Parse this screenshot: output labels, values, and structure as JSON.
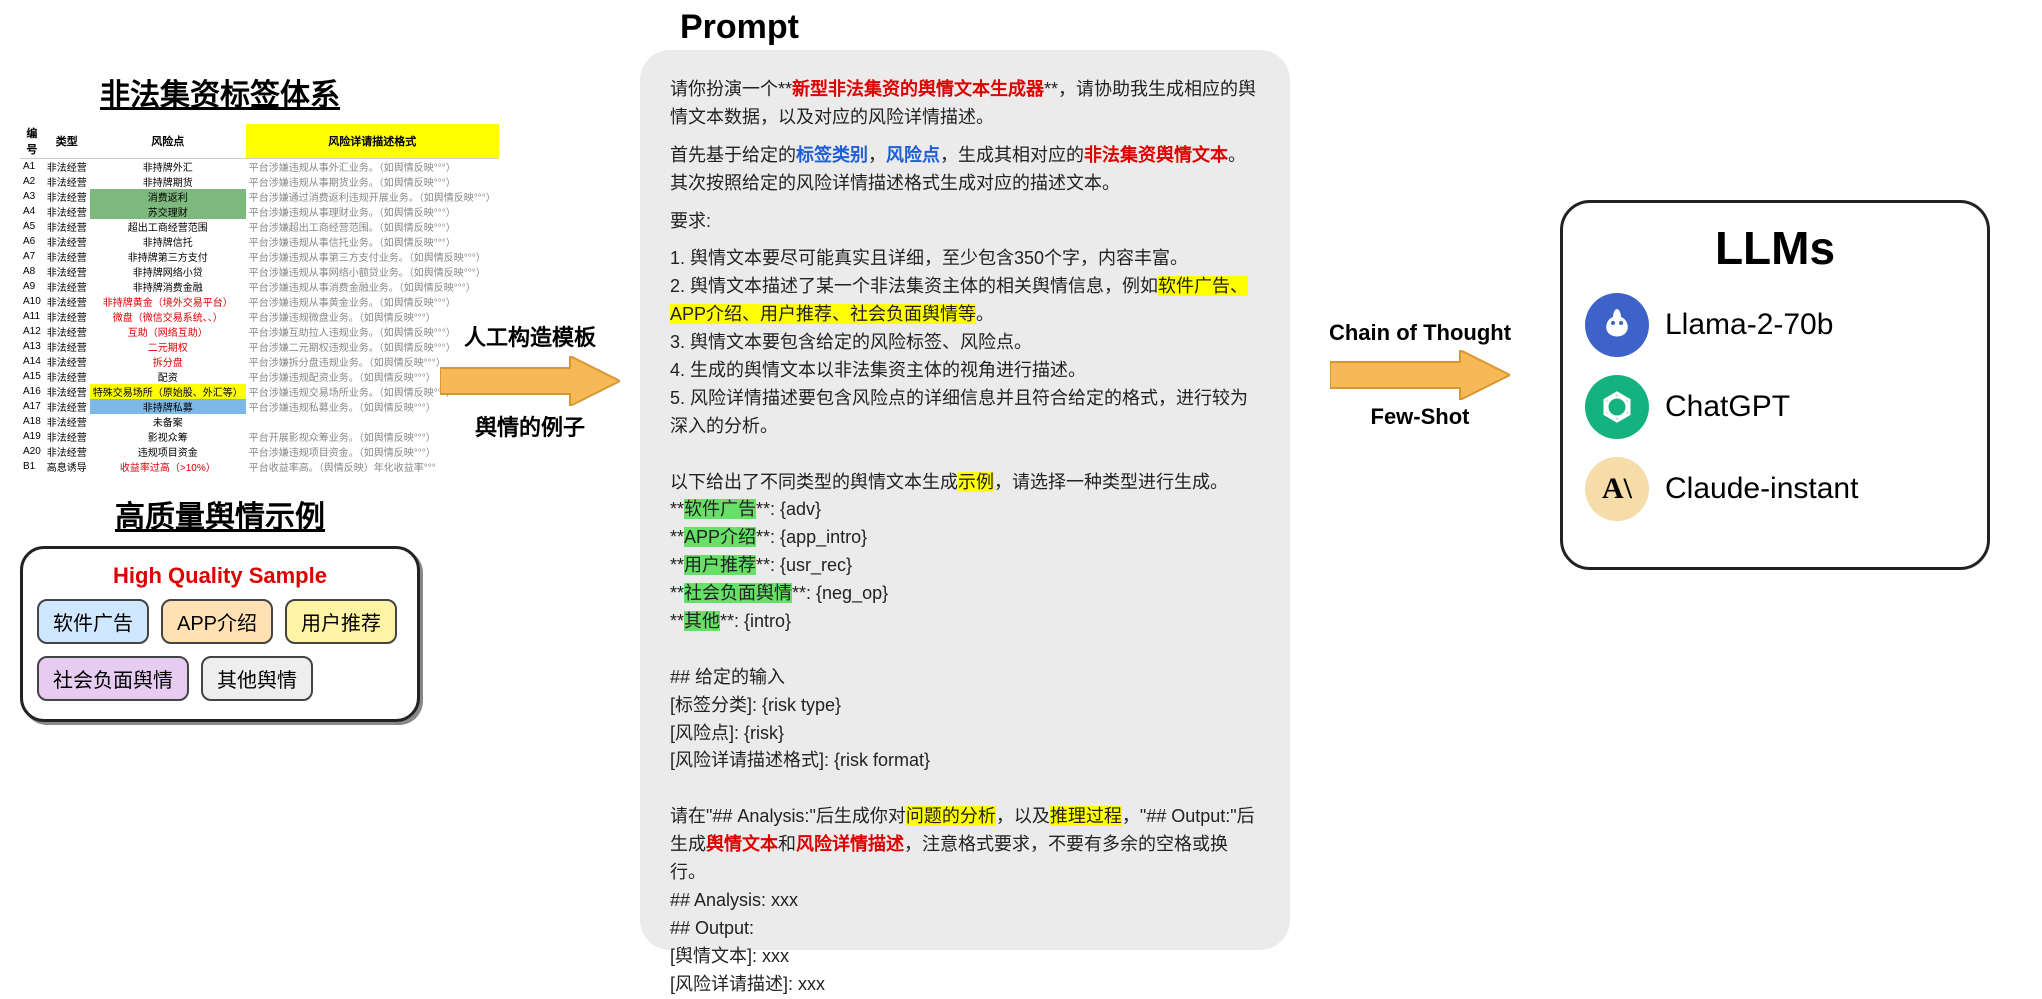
{
  "left": {
    "tag_system_title": "非法集资标签体系",
    "headers": {
      "c1": "编号",
      "c2": "类型",
      "c3": "风险点",
      "c4": "风险详请描述格式"
    },
    "rows": [
      {
        "id": "A1",
        "type": "非法经营",
        "risk": "非持牌外汇",
        "desc": "平台涉嫌违规从事外汇业务。（如舆情反映°°°）",
        "cls": ""
      },
      {
        "id": "A2",
        "type": "非法经营",
        "risk": "非持牌期货",
        "desc": "平台涉嫌违规从事期货业务。（如舆情反映°°°）",
        "cls": ""
      },
      {
        "id": "A3",
        "type": "非法经营",
        "risk": "消费返利",
        "desc": "平台涉嫌通过消费返利违规开展业务。（如舆情反映°°°）",
        "cls": "green-cell"
      },
      {
        "id": "A4",
        "type": "非法经营",
        "risk": "苏交理财",
        "desc": "平台涉嫌违规从事理财业务。（如舆情反映°°°）",
        "cls": "green-cell"
      },
      {
        "id": "A5",
        "type": "非法经营",
        "risk": "超出工商经营范围",
        "desc": "平台涉嫌超出工商经营范围。（如舆情反映°°°）",
        "cls": ""
      },
      {
        "id": "A6",
        "type": "非法经营",
        "risk": "非持牌信托",
        "desc": "平台涉嫌违规从事信托业务。（如舆情反映°°°）",
        "cls": ""
      },
      {
        "id": "A7",
        "type": "非法经营",
        "risk": "非持牌第三方支付",
        "desc": "平台涉嫌违规从事第三方支付业务。（如舆情反映°°°）",
        "cls": ""
      },
      {
        "id": "A8",
        "type": "非法经营",
        "risk": "非持牌网络小贷",
        "desc": "平台涉嫌违规从事网络小额贷业务。（如舆情反映°°°）",
        "cls": ""
      },
      {
        "id": "A9",
        "type": "非法经营",
        "risk": "非持牌消费金融",
        "desc": "平台涉嫌违规从事消费金融业务。（如舆情反映°°°）",
        "cls": ""
      },
      {
        "id": "A10",
        "type": "非法经营",
        "risk": "非持牌黄金（境外交易平台）",
        "desc": "平台涉嫌违规从事黄金业务。（如舆情反映°°°）",
        "cls": "red-text"
      },
      {
        "id": "A11",
        "type": "非法经营",
        "risk": "微盘（微信交易系统、、）",
        "desc": "平台涉嫌违规微盘业务。（如舆情反映°°°）",
        "cls": "red-text"
      },
      {
        "id": "A12",
        "type": "非法经营",
        "risk": "互助（网络互助）",
        "desc": "平台涉嫌互助拉人违规业务。（如舆情反映°°°）",
        "cls": "red-text"
      },
      {
        "id": "A13",
        "type": "非法经营",
        "risk": "二元期权",
        "desc": "平台涉嫌二元期权违规业务。（如舆情反映°°°）",
        "cls": "red-text"
      },
      {
        "id": "A14",
        "type": "非法经营",
        "risk": "拆分盘",
        "desc": "平台涉嫌拆分盘违规业务。（如舆情反映°°°）",
        "cls": "red-text"
      },
      {
        "id": "A15",
        "type": "非法经营",
        "risk": "配资",
        "desc": "平台涉嫌违规配资业务。（如舆情反映°°°）",
        "cls": ""
      },
      {
        "id": "A16",
        "type": "非法经营",
        "risk": "特殊交易场所（原始股、外汇等）",
        "desc": "平台涉嫌违规交易场所业务。（如舆情反映°°°）",
        "cls": "yellow-cell"
      },
      {
        "id": "A17",
        "type": "非法经营",
        "risk": "非持牌私募",
        "desc": "平台涉嫌违规私募业务。（如舆情反映°°°）",
        "cls": "blue-cell"
      },
      {
        "id": "A18",
        "type": "非法经营",
        "risk": "未备案",
        "desc": "",
        "cls": ""
      },
      {
        "id": "A19",
        "type": "非法经营",
        "risk": "影视众筹",
        "desc": "平台开展影视众筹业务。（如舆情反映°°°）",
        "cls": ""
      },
      {
        "id": "A20",
        "type": "非法经营",
        "risk": "违规项目资金",
        "desc": "平台涉嫌违规项目资金。（如舆情反映°°°）",
        "cls": ""
      },
      {
        "id": "B1",
        "type": "高息诱导",
        "risk": "收益率过高（>10%）",
        "desc": "平台收益率高。（舆情反映）年化收益率°°°",
        "cls": "red-text"
      }
    ],
    "sample_title": "高质量舆情示例",
    "hq_label": "High Quality Sample",
    "badges": {
      "software_ad": "软件广告",
      "app_intro": "APP介绍",
      "user_rec": "用户推荐",
      "neg_op": "社会负面舆情",
      "other": "其他舆情"
    }
  },
  "arrows": {
    "a1_top": "人工构造模板",
    "a1_bottom": "舆情的例子",
    "a2_top": "Chain of Thought",
    "a2_bottom": "Few-Shot"
  },
  "prompt": {
    "title": "Prompt",
    "p1a": "请你扮演一个**",
    "p1b": "新型非法集资的舆情文本生成器",
    "p1c": "**，请协助我生成相应的舆情文本数据，以及对应的风险详情描述。",
    "p2a": "首先基于给定的",
    "p2b": "标签类别",
    "p2c": "，",
    "p2d": "风险点",
    "p2e": "，生成其相对应的",
    "p2f": "非法集资舆情文本",
    "p2g": "。其次按照给定的风险详情描述格式生成对应的描述文本。",
    "req_head": "要求:",
    "req1": "1. 舆情文本要尽可能真实且详细，至少包含350个字，内容丰富。",
    "req2a": "2. 舆情文本描述了某一个非法集资主体的相关舆情信息，例如",
    "req2b": "软件广告、APP介绍、用户推荐、社会负面舆情等",
    "req2c": "。",
    "req3": "3. 舆情文本要包含给定的风险标签、风险点。",
    "req4": "4. 生成的舆情文本以非法集资主体的视角进行描述。",
    "req5": "5. 风险详情描述要包含风险点的详细信息并且符合给定的格式，进行较为深入的分析。",
    "ex_head_a": "以下给出了不同类型的舆情文本生成",
    "ex_head_b": "示例",
    "ex_head_c": "，请选择一种类型进行生成。",
    "ex1a": "软件广告",
    "ex1b": "**: {adv}",
    "ex2a": "APP介绍",
    "ex2b": "**: {app_intro}",
    "ex3a": "用户推荐",
    "ex3b": "**: {usr_rec}",
    "ex4a": "社会负面舆情",
    "ex4b": "**: {neg_op}",
    "ex5a": "其他",
    "ex5b": "**: {intro}",
    "input_head": "## 给定的输入",
    "input1": "[标签分类]: {risk type}",
    "input2": "[风险点]: {risk}",
    "input3": "[风险详请描述格式]: {risk format}",
    "out1a": "请在\"## Analysis:\"后生成你对",
    "out1b": "问题的分析",
    "out1c": "，以及",
    "out1d": "推理过程",
    "out1e": "，\"## Output:\"后生成",
    "out1f": "舆情文本",
    "out1g": "和",
    "out1h": "风险详情描述",
    "out1i": "，注意格式要求，不要有多余的空格或换行。",
    "out2": "## Analysis: xxx",
    "out3": "## Output:",
    "out4": "[舆情文本]: xxx",
    "out5": "[风险详请描述]: xxx"
  },
  "llms": {
    "title": "LLMs",
    "items": [
      {
        "name": "Llama-2-70b",
        "icon": "llama"
      },
      {
        "name": "ChatGPT",
        "icon": "chatgpt"
      },
      {
        "name": "Claude-instant",
        "icon": "claude"
      }
    ]
  }
}
